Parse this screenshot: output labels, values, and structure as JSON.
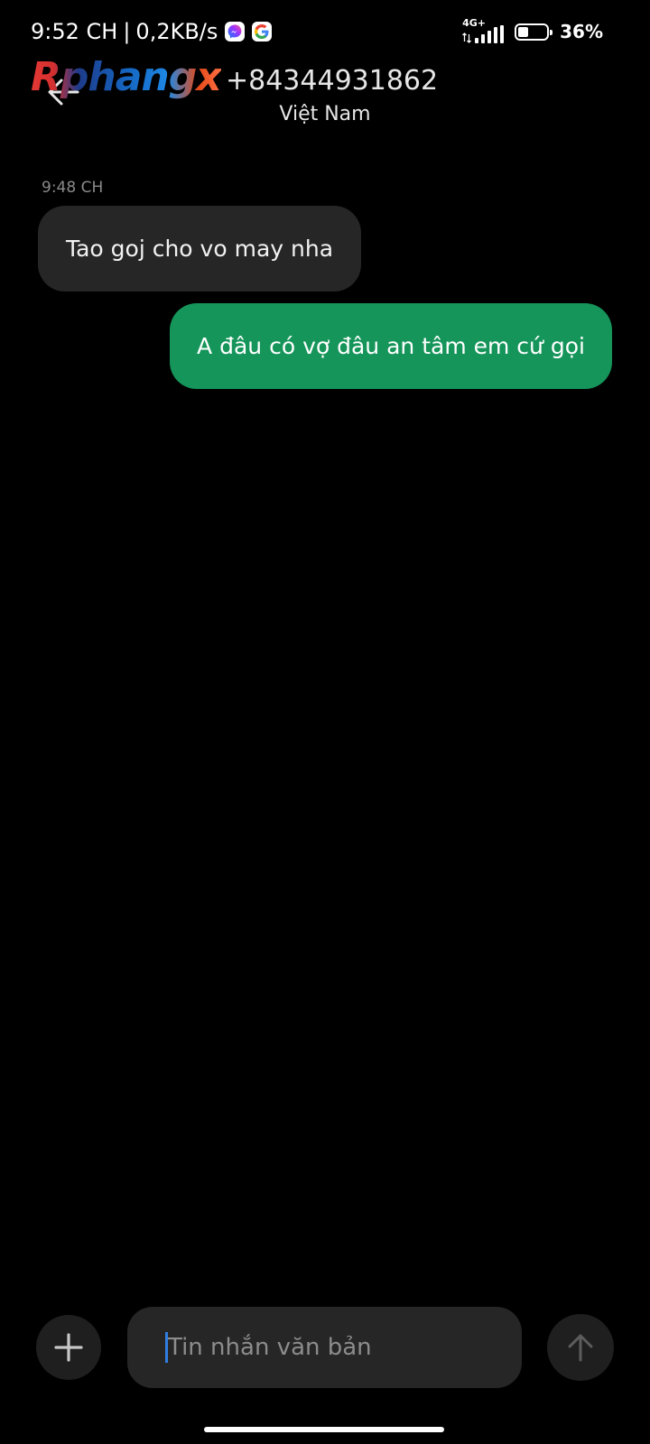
{
  "status_bar": {
    "time": "9:52 CH",
    "separator": "|",
    "network_speed": "0,2KB/s",
    "notification_icons": [
      "messenger-icon",
      "google-icon"
    ],
    "network_type": "4G+",
    "battery_level": 0.36,
    "battery_percent": "36%"
  },
  "header": {
    "back_icon": "arrow-left-icon",
    "watermark": "Rphangx",
    "contact_number": "+84344931862",
    "contact_country": "Việt Nam"
  },
  "messages": {
    "timestamp": "9:48 CH",
    "items": [
      {
        "direction": "incoming",
        "text": "Tao goj cho vo may nha"
      },
      {
        "direction": "outgoing",
        "text": "A đâu có vợ đâu an tâm em cứ gọi"
      }
    ]
  },
  "composer": {
    "add_icon": "plus-icon",
    "placeholder": "Tin nhắn văn bản",
    "send_icon": "arrow-up-icon"
  },
  "colors": {
    "background": "#000000",
    "incoming_bubble": "#262626",
    "outgoing_bubble": "#15955a",
    "caret": "#2f7de1"
  }
}
